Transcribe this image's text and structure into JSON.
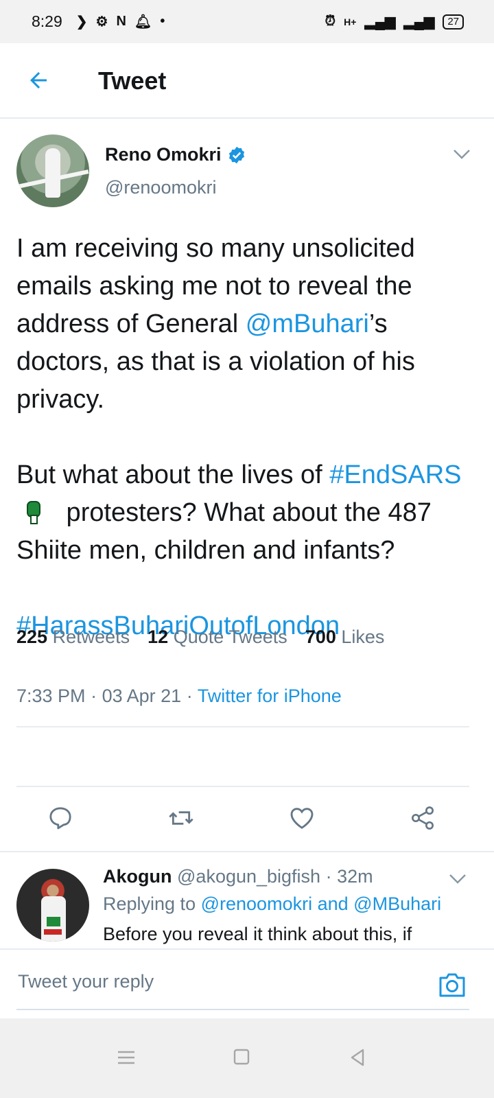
{
  "status_bar": {
    "time": "8:29",
    "network": "H+",
    "battery": "27"
  },
  "header": {
    "title": "Tweet"
  },
  "tweet": {
    "author_name": "Reno Omokri",
    "author_handle": "@renoomokri",
    "text": {
      "p1_before": "I am receiving so many unsolicited emails asking me not to reveal the address of General ",
      "p1_mention": "@mBuhari",
      "p1_after": "’s doctors, as that is a violation of his privacy.",
      "p2_before": "But what about the lives of ",
      "p2_hashtag": "#EndSARS",
      "p2_after": " protesters? What about the 487 Shiite men, children and infants?",
      "p3_hashtag": "#HarassBuhariOutofLondon"
    },
    "time": "7:33 PM",
    "date": "03 Apr 21",
    "source": "Twitter for iPhone",
    "stats": {
      "retweets_count": "225",
      "retweets_label": "Retweets",
      "quotes_count": "12",
      "quotes_label": "Quote Tweets",
      "likes_count": "700",
      "likes_label": "Likes"
    }
  },
  "reply": {
    "name": "Akogun",
    "handle": "@akogun_bigfish",
    "time": "32m",
    "replying_label": "Replying to",
    "replying_to_1": "@renoomokri",
    "replying_and": "and",
    "replying_to_2": "@MBuhari",
    "text": "Before you reveal it think about this, if"
  },
  "compose": {
    "placeholder": "Tweet your reply"
  },
  "colors": {
    "accent": "#1b95e0",
    "muted": "#657786",
    "text": "#14171a",
    "divider": "#e6ecf0"
  },
  "icons": [
    "back-arrow-icon",
    "verified-icon",
    "chevron-down-icon",
    "reply-icon",
    "retweet-icon",
    "like-icon",
    "share-icon",
    "camera-icon",
    "menu-icon",
    "home-icon",
    "back-nav-icon"
  ]
}
